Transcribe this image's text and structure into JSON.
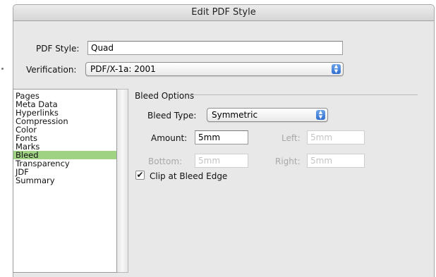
{
  "window": {
    "title": "Edit PDF Style"
  },
  "pdf_style": {
    "label": "PDF Style:",
    "value": "Quad"
  },
  "verification": {
    "label": "Verification:",
    "value": "PDF/X-1a: 2001"
  },
  "categories": [
    {
      "label": "Pages"
    },
    {
      "label": "Meta Data"
    },
    {
      "label": "Hyperlinks"
    },
    {
      "label": "Compression"
    },
    {
      "label": "Color"
    },
    {
      "label": "Fonts"
    },
    {
      "label": "Marks"
    },
    {
      "label": "Bleed",
      "selected": true
    },
    {
      "label": "Transparency"
    },
    {
      "label": "JDF"
    },
    {
      "label": "Summary"
    }
  ],
  "bleed": {
    "section_title": "Bleed Options",
    "type_label": "Bleed Type:",
    "type_value": "Symmetric",
    "amount_label": "Amount:",
    "amount_value": "5mm",
    "left_label": "Left:",
    "left_value": "5mm",
    "bottom_label": "Bottom:",
    "bottom_value": "5mm",
    "right_label": "Right:",
    "right_value": "5mm",
    "clip_label": "Clip at Bleed Edge",
    "clip_checked": true
  },
  "colors": {
    "selection": "#9fd283",
    "popup_arrow": "#2f6fd0",
    "window_bg": "#e8e8e8"
  },
  "icons": {
    "popup_arrows": "up-down-chevron-icon",
    "checkmark": "checkmark-icon"
  }
}
